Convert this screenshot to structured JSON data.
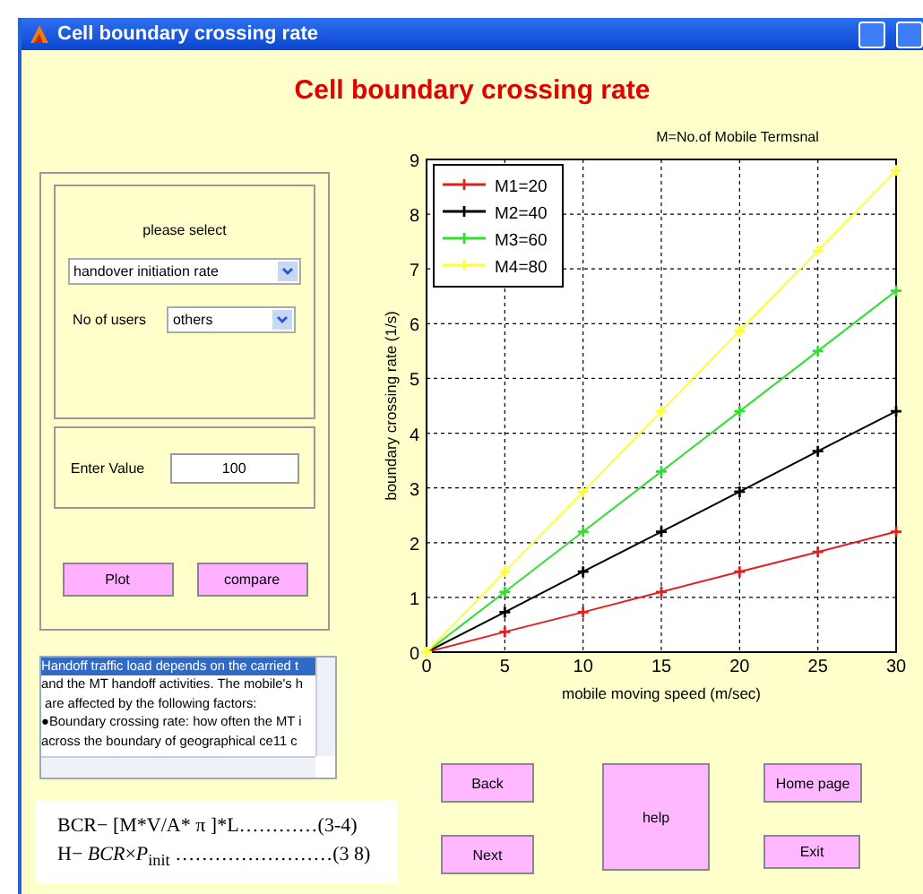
{
  "window": {
    "title": "Cell boundary crossing rate"
  },
  "heading": "Cell boundary crossing rate",
  "selection_panel": {
    "label": "please select",
    "measure": {
      "value": "handover initiation rate"
    },
    "users": {
      "label": "No of users",
      "value": "others"
    }
  },
  "value_panel": {
    "label": "Enter Value",
    "value": "100"
  },
  "panel_buttons": [
    "Plot",
    "compare"
  ],
  "info_list": {
    "lines": [
      {
        "text": "Handoff traffic load depends on the carried t",
        "selected": true
      },
      {
        "text": "and the MT handoff activities. The mobile's h",
        "selected": false
      },
      {
        "text": " are affected by the following factors:",
        "selected": false
      },
      {
        "text": "●Boundary crossing rate: how often the MT i",
        "selected": false
      },
      {
        "text": "across the boundary of geographical ce11 c",
        "selected": false
      }
    ]
  },
  "formulas": [
    {
      "text": "BCR− [M*V/A* π ]*L…………(3-4)"
    },
    {
      "text": "H− *BCR*×*P*$_{init}$ ……………………(3 8)"
    }
  ],
  "plot": {
    "chart_data": {
      "type": "line",
      "title": "M=No.of Mobile Termsnal",
      "xlabel": "mobile moving speed (m/sec)",
      "ylabel": "boundary crossing rate (1/s)",
      "x": [
        0,
        5,
        10,
        15,
        20,
        25,
        30
      ],
      "xlim": [
        0,
        30
      ],
      "ylim": [
        0,
        9
      ],
      "xticks": [
        0,
        5,
        10,
        15,
        20,
        25,
        30
      ],
      "yticks": [
        0,
        1,
        2,
        3,
        4,
        5,
        6,
        7,
        8,
        9
      ],
      "grid": true,
      "legend": true,
      "series": [
        {
          "name": "M1=20",
          "color": "#e02020",
          "marker": "+",
          "values": [
            0,
            0.37,
            0.73,
            1.1,
            1.47,
            1.83,
            2.2
          ]
        },
        {
          "name": "M2=40",
          "color": "#000000",
          "marker": "+",
          "values": [
            0,
            0.73,
            1.47,
            2.2,
            2.93,
            3.67,
            4.4
          ]
        },
        {
          "name": "M3=60",
          "color": "#33dd33",
          "marker": "+",
          "values": [
            0,
            1.1,
            2.2,
            3.3,
            4.4,
            5.5,
            6.6
          ]
        },
        {
          "name": "M4=80",
          "color": "#ffff33",
          "marker": "+",
          "values": [
            0,
            1.47,
            2.93,
            4.4,
            5.87,
            7.33,
            8.8
          ]
        }
      ]
    }
  },
  "nav_buttons": {
    "back": "Back",
    "next": "Next",
    "help": "help",
    "home": "Home page",
    "exit": "Exit"
  }
}
